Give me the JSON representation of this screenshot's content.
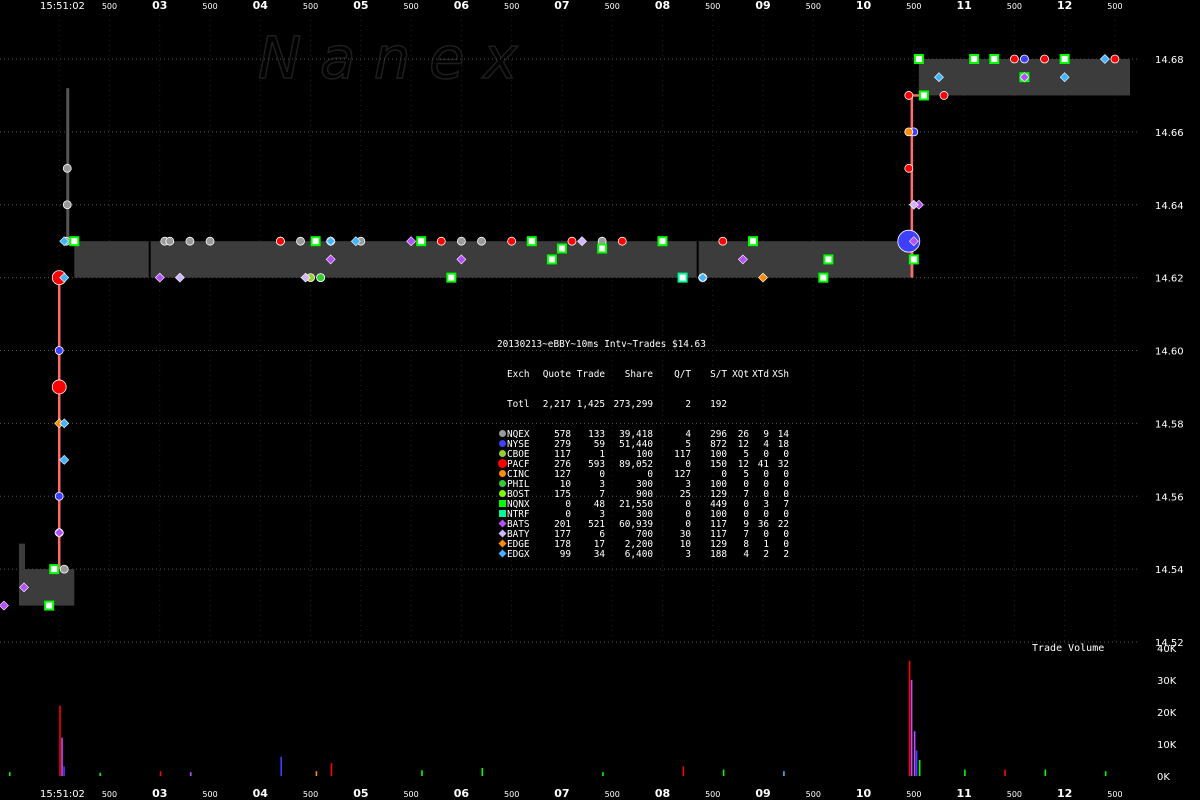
{
  "watermark": "N a n e x",
  "chart_data": [
    {
      "type": "scatter",
      "title": "20130213~eBBY~10ms Intv~Trades $14.63",
      "y_labels": [
        "14.68",
        "14.66",
        "14.64",
        "14.62",
        "14.60",
        "14.58",
        "14.56",
        "14.54",
        "14.52"
      ],
      "ylim": [
        14.52,
        14.68
      ],
      "x_labels_top": [
        "15:51:02",
        "500",
        "03",
        "500",
        "04",
        "500",
        "05",
        "500",
        "06",
        "500",
        "07",
        "500",
        "08",
        "500",
        "09",
        "500",
        "10",
        "500",
        "11",
        "500",
        "12",
        "500"
      ],
      "x_labels_bottom": [
        "15:51:02",
        "500",
        "03",
        "500",
        "04",
        "500",
        "05",
        "500",
        "06",
        "500",
        "07",
        "500",
        "08",
        "500",
        "09",
        "500",
        "10",
        "500",
        "11",
        "500",
        "12",
        "500"
      ],
      "xlim_seconds": [
        1.6,
        12.65
      ],
      "nbbo_bands": [
        {
          "x0": 1.6,
          "x1": 2.15,
          "bid": 14.53,
          "ask": 14.54
        },
        {
          "x0": 2.15,
          "x1": 10.5,
          "bid": 14.62,
          "ask": 14.63
        },
        {
          "x0": 10.55,
          "x1": 12.65,
          "bid": 14.67,
          "ask": 14.68
        }
      ],
      "series": [
        {
          "name": "NQEX",
          "color": "#9a9a9a",
          "marker": "circle",
          "points": [
            [
              2.05,
              14.54
            ],
            [
              2.07,
              14.63
            ],
            [
              2.08,
              14.64
            ],
            [
              2.08,
              14.65
            ],
            [
              3.05,
              14.63
            ],
            [
              3.1,
              14.63
            ],
            [
              3.3,
              14.63
            ],
            [
              3.5,
              14.63
            ],
            [
              4.2,
              14.63
            ],
            [
              4.4,
              14.63
            ],
            [
              5.0,
              14.63
            ],
            [
              6.0,
              14.63
            ],
            [
              6.2,
              14.63
            ],
            [
              7.4,
              14.63
            ],
            [
              10.45,
              14.63
            ]
          ]
        },
        {
          "name": "NYSE",
          "color": "#3f3fff",
          "marker": "circle",
          "points": [
            [
              2.0,
              14.6
            ],
            [
              2.0,
              14.55
            ],
            [
              2.0,
              14.56
            ],
            [
              4.2,
              14.63
            ],
            [
              10.45,
              14.63
            ],
            [
              10.5,
              14.66
            ],
            [
              11.6,
              14.68
            ]
          ]
        },
        {
          "name": "CBOE",
          "color": "#9acd32",
          "marker": "circle",
          "points": [
            [
              4.5,
              14.62
            ],
            [
              4.6,
              14.62
            ]
          ]
        },
        {
          "name": "PACF",
          "color": "#ff0000",
          "marker": "circle",
          "points": [
            [
              2.0,
              14.62
            ],
            [
              2.0,
              14.59
            ],
            [
              4.2,
              14.63
            ],
            [
              4.7,
              14.63
            ],
            [
              5.8,
              14.63
            ],
            [
              6.5,
              14.63
            ],
            [
              7.1,
              14.63
            ],
            [
              7.6,
              14.63
            ],
            [
              8.4,
              14.62
            ],
            [
              8.6,
              14.63
            ],
            [
              10.45,
              14.67
            ],
            [
              10.45,
              14.65
            ],
            [
              10.8,
              14.67
            ],
            [
              11.5,
              14.68
            ],
            [
              11.8,
              14.68
            ],
            [
              12.5,
              14.68
            ]
          ]
        },
        {
          "name": "CINC",
          "color": "#ff8c00",
          "marker": "circle",
          "points": [
            [
              10.45,
              14.66
            ]
          ]
        },
        {
          "name": "PHIL",
          "color": "#32cd32",
          "marker": "circle",
          "points": [
            [
              4.6,
              14.62
            ]
          ]
        },
        {
          "name": "BOST",
          "color": "#7cfc00",
          "marker": "circle",
          "points": [
            [
              10.5,
              14.625
            ]
          ]
        },
        {
          "name": "NQNX",
          "color": "#00ff00",
          "marker": "square",
          "points": [
            [
              1.9,
              14.53
            ],
            [
              1.95,
              14.54
            ],
            [
              2.15,
              14.63
            ],
            [
              4.55,
              14.63
            ],
            [
              5.6,
              14.63
            ],
            [
              5.9,
              14.62
            ],
            [
              6.7,
              14.63
            ],
            [
              6.9,
              14.625
            ],
            [
              7.0,
              14.628
            ],
            [
              7.4,
              14.628
            ],
            [
              8.0,
              14.63
            ],
            [
              8.9,
              14.63
            ],
            [
              9.6,
              14.62
            ],
            [
              9.65,
              14.625
            ],
            [
              10.5,
              14.625
            ],
            [
              10.55,
              14.68
            ],
            [
              10.6,
              14.67
            ],
            [
              11.1,
              14.68
            ],
            [
              11.3,
              14.68
            ],
            [
              11.6,
              14.675
            ],
            [
              12.0,
              14.68
            ]
          ]
        },
        {
          "name": "NTRF",
          "color": "#00fa9a",
          "marker": "square",
          "points": [
            [
              8.2,
              14.62
            ]
          ]
        },
        {
          "name": "BATS",
          "color": "#b84fff",
          "marker": "diamond",
          "points": [
            [
              1.45,
              14.53
            ],
            [
              1.65,
              14.535
            ],
            [
              2.0,
              14.55
            ],
            [
              3.0,
              14.62
            ],
            [
              4.7,
              14.625
            ],
            [
              5.5,
              14.63
            ],
            [
              6.0,
              14.625
            ],
            [
              8.8,
              14.625
            ],
            [
              10.5,
              14.63
            ],
            [
              10.55,
              14.64
            ],
            [
              11.6,
              14.675
            ]
          ]
        },
        {
          "name": "BATY",
          "color": "#d2b4ff",
          "marker": "diamond",
          "points": [
            [
              3.2,
              14.62
            ],
            [
              4.45,
              14.62
            ],
            [
              7.2,
              14.63
            ],
            [
              10.5,
              14.64
            ]
          ]
        },
        {
          "name": "EDGE",
          "color": "#ff8c00",
          "marker": "diamond",
          "points": [
            [
              2.0,
              14.58
            ],
            [
              9.0,
              14.62
            ]
          ]
        },
        {
          "name": "EDGX",
          "color": "#3fb6ff",
          "marker": "diamond",
          "points": [
            [
              2.05,
              14.57
            ],
            [
              2.05,
              14.58
            ],
            [
              2.05,
              14.62
            ],
            [
              2.05,
              14.63
            ],
            [
              4.7,
              14.63
            ],
            [
              4.95,
              14.63
            ],
            [
              8.4,
              14.62
            ],
            [
              10.75,
              14.675
            ],
            [
              12.0,
              14.675
            ],
            [
              12.4,
              14.68
            ]
          ]
        }
      ]
    },
    {
      "type": "bar",
      "title": "Trade Volume",
      "y_labels": [
        "40K",
        "30K",
        "20K",
        "10K",
        "0K"
      ],
      "ylim": [
        0,
        40000
      ],
      "bars": [
        {
          "x": 2.0,
          "value": 22000,
          "color": "#ff0000"
        },
        {
          "x": 2.02,
          "value": 12000,
          "color": "#b84fff"
        },
        {
          "x": 2.04,
          "value": 3000,
          "color": "#3f3fff"
        },
        {
          "x": 1.5,
          "value": 1200,
          "color": "#00ff00"
        },
        {
          "x": 2.4,
          "value": 1000,
          "color": "#00ff00"
        },
        {
          "x": 3.0,
          "value": 1500,
          "color": "#ff0000"
        },
        {
          "x": 3.3,
          "value": 1200,
          "color": "#b84fff"
        },
        {
          "x": 4.2,
          "value": 6000,
          "color": "#3f3fff"
        },
        {
          "x": 4.7,
          "value": 4000,
          "color": "#ff0000"
        },
        {
          "x": 4.55,
          "value": 1500,
          "color": "#ff8c00"
        },
        {
          "x": 5.6,
          "value": 1800,
          "color": "#00ff00"
        },
        {
          "x": 6.2,
          "value": 2500,
          "color": "#00ff00"
        },
        {
          "x": 7.4,
          "value": 1200,
          "color": "#00ff00"
        },
        {
          "x": 8.2,
          "value": 3000,
          "color": "#ff0000"
        },
        {
          "x": 8.6,
          "value": 2000,
          "color": "#00ff00"
        },
        {
          "x": 9.2,
          "value": 1500,
          "color": "#3fb6ff"
        },
        {
          "x": 10.45,
          "value": 36000,
          "color": "#ff0000"
        },
        {
          "x": 10.47,
          "value": 30000,
          "color": "#b84fff"
        },
        {
          "x": 10.5,
          "value": 14000,
          "color": "#b84fff"
        },
        {
          "x": 10.52,
          "value": 8000,
          "color": "#3f3fff"
        },
        {
          "x": 10.55,
          "value": 5000,
          "color": "#00ff00"
        },
        {
          "x": 11.0,
          "value": 2000,
          "color": "#00ff00"
        },
        {
          "x": 11.4,
          "value": 2000,
          "color": "#ff0000"
        },
        {
          "x": 11.8,
          "value": 2000,
          "color": "#00ff00"
        },
        {
          "x": 12.4,
          "value": 1500,
          "color": "#00ff00"
        }
      ]
    }
  ],
  "stats_table": {
    "title": "20130213~eBBY~10ms Intv~Trades $14.63",
    "header": [
      "Exch",
      "Quote",
      "Trade",
      "Share",
      "Q/T",
      "S/T",
      "XQt",
      "XTd",
      "XSh"
    ],
    "total": [
      "Totl",
      "2,217",
      "1,425",
      "273,299",
      "2",
      "192",
      "",
      "",
      ""
    ],
    "rows": [
      {
        "marker": "circle",
        "color": "#9a9a9a",
        "cells": [
          "NQEX",
          "578",
          "133",
          "39,418",
          "4",
          "296",
          "26",
          "9",
          "14"
        ]
      },
      {
        "marker": "circle",
        "color": "#3f3fff",
        "cells": [
          "NYSE",
          "279",
          "59",
          "51,440",
          "5",
          "872",
          "12",
          "4",
          "18"
        ]
      },
      {
        "marker": "circle",
        "color": "#9acd32",
        "cells": [
          "CBOE",
          "117",
          "1",
          "100",
          "117",
          "100",
          "5",
          "0",
          "0"
        ]
      },
      {
        "marker": "circle-big",
        "color": "#ff0000",
        "cells": [
          "PACF",
          "276",
          "593",
          "89,052",
          "0",
          "150",
          "12",
          "41",
          "32"
        ]
      },
      {
        "marker": "circle",
        "color": "#ff8c00",
        "cells": [
          "CINC",
          "127",
          "0",
          "0",
          "127",
          "0",
          "5",
          "0",
          "0"
        ]
      },
      {
        "marker": "circle",
        "color": "#32cd32",
        "cells": [
          "PHIL",
          "10",
          "3",
          "300",
          "3",
          "100",
          "0",
          "0",
          "0"
        ]
      },
      {
        "marker": "circle",
        "color": "#7cfc00",
        "cells": [
          "BOST",
          "175",
          "7",
          "900",
          "25",
          "129",
          "7",
          "0",
          "0"
        ]
      },
      {
        "marker": "square",
        "color": "#00ff00",
        "cells": [
          "NQNX",
          "0",
          "48",
          "21,550",
          "0",
          "449",
          "0",
          "3",
          "7"
        ]
      },
      {
        "marker": "square",
        "color": "#00fa9a",
        "cells": [
          "NTRF",
          "0",
          "3",
          "300",
          "0",
          "100",
          "0",
          "0",
          "0"
        ]
      },
      {
        "marker": "diamond",
        "color": "#b84fff",
        "cells": [
          "BATS",
          "201",
          "521",
          "60,939",
          "0",
          "117",
          "9",
          "36",
          "22"
        ]
      },
      {
        "marker": "diamond",
        "color": "#d2b4ff",
        "cells": [
          "BATY",
          "177",
          "6",
          "700",
          "30",
          "117",
          "7",
          "0",
          "0"
        ]
      },
      {
        "marker": "diamond",
        "color": "#ff8c00",
        "cells": [
          "EDGE",
          "178",
          "17",
          "2,200",
          "10",
          "129",
          "8",
          "1",
          "0"
        ]
      },
      {
        "marker": "diamond",
        "color": "#3fb6ff",
        "cells": [
          "EDGX",
          "99",
          "34",
          "6,400",
          "3",
          "188",
          "4",
          "2",
          "2"
        ]
      }
    ]
  }
}
